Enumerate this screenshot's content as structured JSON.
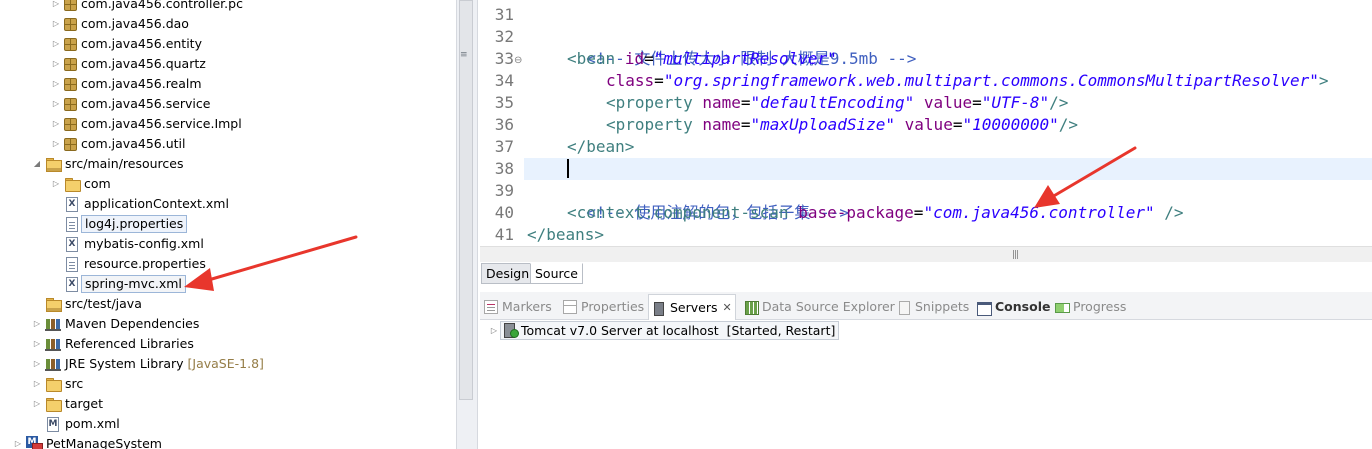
{
  "explorer": {
    "items": [
      {
        "label": "com.java456.controller.pc",
        "icon": "package-icon"
      },
      {
        "label": "com.java456.dao",
        "icon": "package-icon"
      },
      {
        "label": "com.java456.entity",
        "icon": "package-icon"
      },
      {
        "label": "com.java456.quartz",
        "icon": "package-icon"
      },
      {
        "label": "com.java456.realm",
        "icon": "package-icon"
      },
      {
        "label": "com.java456.service",
        "icon": "package-icon"
      },
      {
        "label": "com.java456.service.Impl",
        "icon": "package-icon"
      },
      {
        "label": "com.java456.util",
        "icon": "package-icon"
      },
      {
        "label": "src/main/resources",
        "icon": "source-folder-icon"
      },
      {
        "label": "com",
        "icon": "folder-icon"
      },
      {
        "label": "applicationContext.xml",
        "icon": "xml-file-icon"
      },
      {
        "label": "log4j.properties",
        "icon": "properties-file-icon"
      },
      {
        "label": "mybatis-config.xml",
        "icon": "xml-file-icon"
      },
      {
        "label": "resource.properties",
        "icon": "properties-file-icon"
      },
      {
        "label": "spring-mvc.xml",
        "icon": "xml-file-icon"
      },
      {
        "label": "src/test/java",
        "icon": "source-folder-icon"
      },
      {
        "label": "Maven Dependencies",
        "icon": "library-icon"
      },
      {
        "label": "Referenced Libraries",
        "icon": "library-icon"
      },
      {
        "label": "JRE System Library",
        "decoration": "[JavaSE-1.8]",
        "icon": "library-icon"
      },
      {
        "label": "src",
        "icon": "folder-icon"
      },
      {
        "label": "target",
        "icon": "folder-icon"
      },
      {
        "label": "pom.xml",
        "icon": "maven-pom-icon"
      },
      {
        "label": "PetManageSystem",
        "icon": "maven-project-icon"
      }
    ]
  },
  "editor": {
    "line_numbers": [
      "31",
      "32",
      "33",
      "34",
      "35",
      "36",
      "37",
      "38",
      "39",
      "40",
      "41"
    ],
    "fold_marker": "⊖",
    "lines": {
      "l32_comment": "<!-- 文件上传大小 限制 大概是9.5mb -->",
      "l33_open": "<bean",
      "l33_attr": "id",
      "l33_eq": "=",
      "l33_val": "\"multipartResolver\"",
      "l34_attr": "class",
      "l34_eq": "=",
      "l34_val": "\"org.springframework.web.multipart.commons.CommonsMultipartResolver\"",
      "l34_close": ">",
      "l35_open": "<property",
      "l35_attr1": "name",
      "l35_val1": "\"defaultEncoding\"",
      "l35_attr2": "value",
      "l35_val2": "\"UTF-8\"",
      "l35_close": "/>",
      "l36_open": "<property",
      "l36_attr1": "name",
      "l36_val1": "\"maxUploadSize\"",
      "l36_attr2": "value",
      "l36_val2": "\"10000000\"",
      "l36_close": "/>",
      "l37": "</bean>",
      "l39_comment": "<!-- 使用注解的包，包括子集 -->",
      "l40_open": "<context:component-scan",
      "l40_attr": "base-package",
      "l40_val": "\"com.java456.controller\"",
      "l40_close": "/>",
      "l41": "</beans>"
    },
    "scroll_grip": "|||",
    "tabs": {
      "design": "Design",
      "source": "Source"
    }
  },
  "views": {
    "tabs": {
      "markers": "Markers",
      "properties": "Properties",
      "servers": "Servers",
      "data_source_explorer": "Data Source Explorer",
      "snippets": "Snippets",
      "console": "Console",
      "progress": "Progress"
    },
    "close_glyph": "✕",
    "server": {
      "name": "Tomcat v7.0 Server at localhost",
      "state": "[Started, Restart]"
    }
  },
  "colors": {
    "annotation_arrow": "#e8362c",
    "current_line": "#e8f2fe"
  }
}
